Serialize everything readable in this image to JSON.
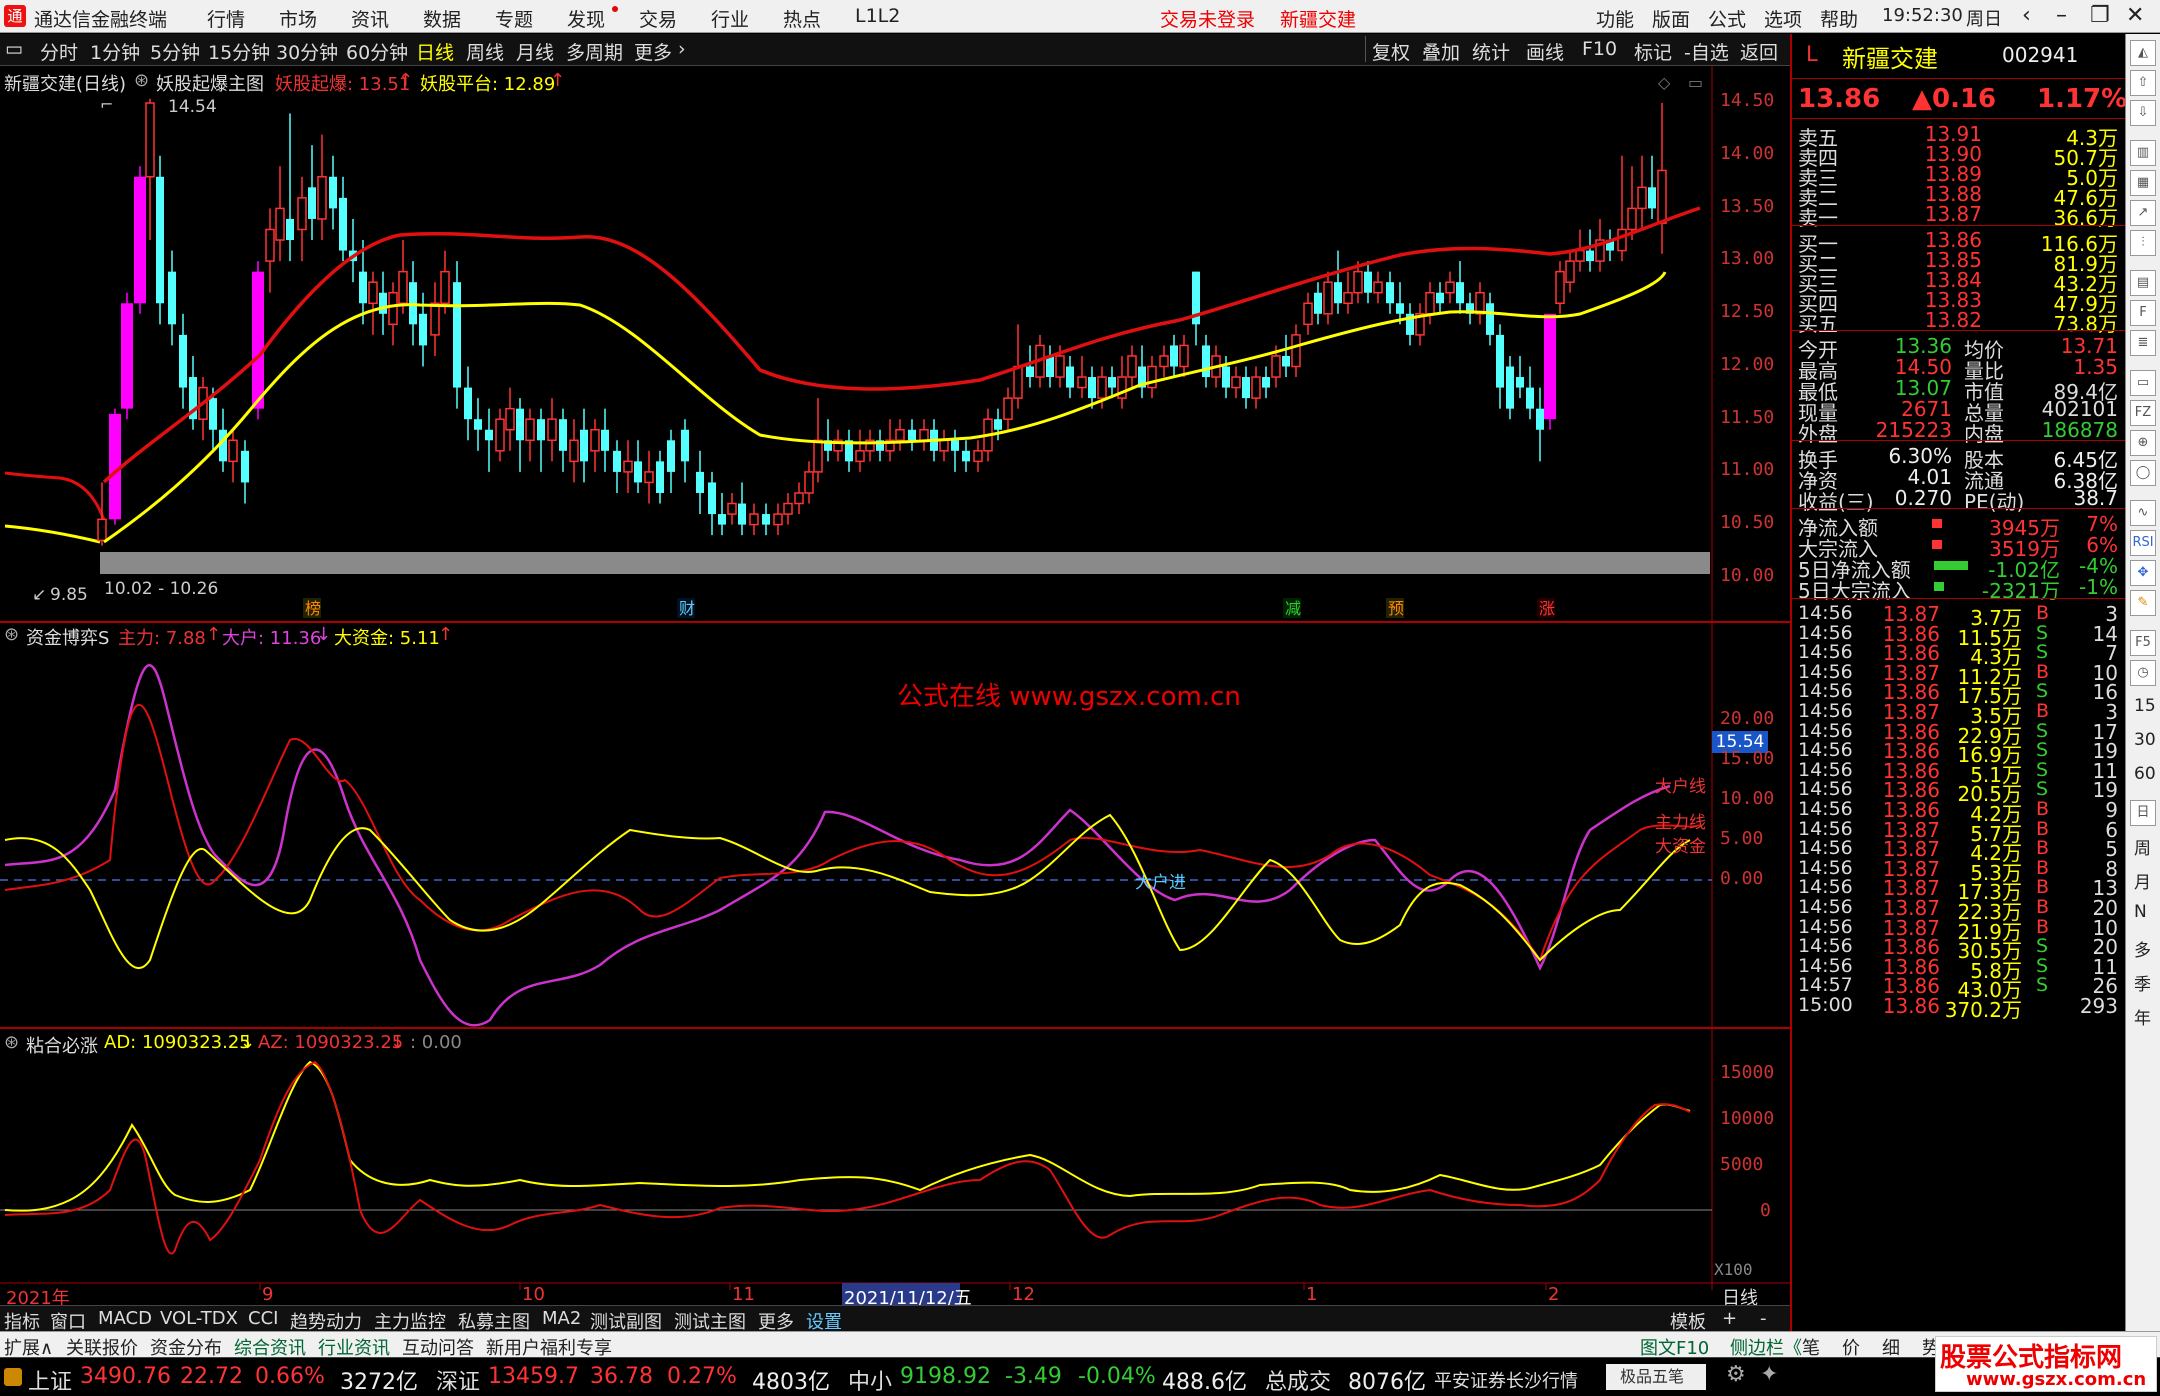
{
  "app": {
    "title": "通达信金融终端",
    "menu": [
      "行情",
      "市场",
      "资讯",
      "数据",
      "专题",
      "发现",
      "交易",
      "行业",
      "热点",
      "L1L2"
    ],
    "trade_status": "交易未登录",
    "stock_name_top": "新疆交建",
    "right_menu": [
      "功能",
      "版面",
      "公式",
      "选项",
      "帮助"
    ],
    "time": "19:52:30",
    "weekday": "周日"
  },
  "toolbar": {
    "periods": [
      "分时",
      "1分钟",
      "5分钟",
      "15分钟",
      "30分钟",
      "60分钟",
      "日线",
      "周线",
      "月线",
      "多周期",
      "更多"
    ],
    "selected": "日线",
    "right": [
      "复权",
      "叠加",
      "统计",
      "画线",
      "F10",
      "标记",
      "-自选",
      "返回"
    ]
  },
  "main": {
    "title": "新疆交建(日线)",
    "indicator": "妖股起爆主图",
    "l1": "妖股起爆: 13.51",
    "l2": "妖股平台: 12.89",
    "high_label": "14.54",
    "low_label": "9.85",
    "range_label": "10.02 - 10.26",
    "yticks": [
      "14.50",
      "14.00",
      "13.50",
      "13.00",
      "12.50",
      "12.00",
      "11.50",
      "11.00",
      "10.50",
      "10.00"
    ],
    "markers": [
      {
        "t": "榜",
        "c": "#f80"
      },
      {
        "t": "财",
        "c": "#6cf"
      },
      {
        "t": "减",
        "c": "#3c3"
      },
      {
        "t": "预",
        "c": "#f80"
      },
      {
        "t": "涨",
        "c": "#f33"
      }
    ]
  },
  "p2": {
    "title": "资金博弈S",
    "l1": "主力: 7.88",
    "l2": "大户: 11.36",
    "l3": "大资金: 5.11",
    "watermark": "公式在线 www.gszx.com.cn",
    "yticks": [
      "20.00",
      "15.00",
      "10.00",
      "5.00",
      "0.00"
    ],
    "cur": "15.54",
    "lab_dahu": "大户线",
    "lab_zhuli": "主力线",
    "lab_dazijin": "大资金",
    "lab_jin": "大户进"
  },
  "p3": {
    "title": "粘合必涨",
    "l1": "AD: 1090323.25",
    "l2": "AZ: 1090323.25",
    "l3": ": 0.00",
    "yticks": [
      "15000",
      "10000",
      "5000",
      "0"
    ],
    "scale": "X100"
  },
  "xaxis": {
    "labels": [
      "2021年",
      "9",
      "10",
      "11",
      "2021/11/12/五",
      "12",
      "1",
      "2"
    ],
    "right": "日线"
  },
  "quote": {
    "code_prefix": "L",
    "name": "新疆交建",
    "code": "002941",
    "price": "13.86",
    "change": "▲0.16",
    "pct": "1.17%",
    "asks": [
      {
        "l": "卖五",
        "p": "13.91",
        "v": "4.3万"
      },
      {
        "l": "卖四",
        "p": "13.90",
        "v": "50.7万"
      },
      {
        "l": "卖三",
        "p": "13.89",
        "v": "5.0万"
      },
      {
        "l": "卖二",
        "p": "13.88",
        "v": "47.6万"
      },
      {
        "l": "卖一",
        "p": "13.87",
        "v": "36.6万"
      }
    ],
    "bids": [
      {
        "l": "买一",
        "p": "13.86",
        "v": "116.6万"
      },
      {
        "l": "买二",
        "p": "13.85",
        "v": "81.9万"
      },
      {
        "l": "买三",
        "p": "13.84",
        "v": "43.2万"
      },
      {
        "l": "买四",
        "p": "13.83",
        "v": "47.9万"
      },
      {
        "l": "买五",
        "p": "13.82",
        "v": "73.8万"
      }
    ],
    "stats": [
      [
        "今开",
        "13.36",
        "均价",
        "13.71"
      ],
      [
        "最高",
        "14.50",
        "量比",
        "1.35"
      ],
      [
        "最低",
        "13.07",
        "市值",
        "89.4亿"
      ],
      [
        "现量",
        "2671",
        "总量",
        "402101"
      ],
      [
        "外盘",
        "215223",
        "内盘",
        "186878"
      ]
    ],
    "stats2": [
      [
        "换手",
        "6.30%",
        "股本",
        "6.45亿"
      ],
      [
        "净资",
        "4.01",
        "流通",
        "6.38亿"
      ],
      [
        "收益(三)",
        "0.270",
        "PE(动)",
        "38.7"
      ]
    ],
    "flows": [
      [
        "净流入额",
        "3945万",
        "7%"
      ],
      [
        "大宗流入",
        "3519万",
        "6%"
      ],
      [
        "5日净流入额",
        "-1.02亿",
        "-4%"
      ],
      [
        "5日大宗流入",
        "-2321万",
        "-1%"
      ]
    ],
    "ticks": [
      [
        "14:56",
        "13.87",
        "3.7万",
        "B",
        "3"
      ],
      [
        "14:56",
        "13.86",
        "11.5万",
        "S",
        "14"
      ],
      [
        "14:56",
        "13.86",
        "4.3万",
        "S",
        "7"
      ],
      [
        "14:56",
        "13.87",
        "11.2万",
        "B",
        "10"
      ],
      [
        "14:56",
        "13.86",
        "17.5万",
        "S",
        "16"
      ],
      [
        "14:56",
        "13.87",
        "3.5万",
        "B",
        "3"
      ],
      [
        "14:56",
        "13.86",
        "22.9万",
        "S",
        "17"
      ],
      [
        "14:56",
        "13.86",
        "16.9万",
        "S",
        "19"
      ],
      [
        "14:56",
        "13.86",
        "5.1万",
        "S",
        "11"
      ],
      [
        "14:56",
        "13.86",
        "20.5万",
        "S",
        "19"
      ],
      [
        "14:56",
        "13.86",
        "4.2万",
        "B",
        "9"
      ],
      [
        "14:56",
        "13.87",
        "5.7万",
        "B",
        "6"
      ],
      [
        "14:56",
        "13.87",
        "4.2万",
        "B",
        "5"
      ],
      [
        "14:56",
        "13.87",
        "5.3万",
        "B",
        "8"
      ],
      [
        "14:56",
        "13.87",
        "17.3万",
        "B",
        "13"
      ],
      [
        "14:56",
        "13.87",
        "22.3万",
        "B",
        "20"
      ],
      [
        "14:56",
        "13.87",
        "21.9万",
        "B",
        "10"
      ],
      [
        "14:56",
        "13.86",
        "30.5万",
        "S",
        "20"
      ],
      [
        "14:56",
        "13.86",
        "5.8万",
        "S",
        "11"
      ],
      [
        "14:57",
        "13.86",
        "43.0万",
        "S",
        "26"
      ],
      [
        "15:00",
        "13.86",
        "370.2万",
        "",
        "293"
      ]
    ]
  },
  "sidebar": [
    "日",
    "周",
    "月",
    "N",
    "多",
    "季",
    "年"
  ],
  "bottom_tabs": [
    "指标",
    "窗口",
    "MACD",
    "VOL-TDX",
    "CCI",
    "趋势动力",
    "主力监控",
    "私募主图",
    "MA2",
    "测试副图",
    "测试主图",
    "更多",
    "设置"
  ],
  "bottom_right": [
    "模板",
    "+",
    "-"
  ],
  "bottom2": [
    "扩展∧",
    "关联报价",
    "资金分布",
    "综合资讯",
    "行业资讯",
    "互动问答",
    "新用户福利专享"
  ],
  "bottom2_right": [
    "图文F10",
    "侧边栏《",
    "笔",
    "价",
    "细",
    "势"
  ],
  "status": [
    {
      "n": "上证",
      "v": "3490.76",
      "c": "22.72",
      "p": "0.66%",
      "a": "3272亿"
    },
    {
      "n": "深证",
      "v": "13459.7",
      "c": "36.78",
      "p": "0.27%",
      "a": "4803亿"
    },
    {
      "n": "中小",
      "v": "9198.92",
      "c": "-3.49",
      "p": "-0.04%",
      "a": "488.6亿"
    }
  ],
  "status_extra": {
    "total_label": "总成交",
    "total": "8076亿",
    "broker": "平安证券长沙行情",
    "badge": "极品五笔"
  },
  "site_watermark": {
    "t1": "股票公式指标网",
    "t2": "www.gszx.com.cn"
  },
  "colors": {
    "up": "#ff3333",
    "down": "#54ffff",
    "yao": "#ff00ff",
    "ma_red": "#e01010",
    "ma_yellow": "#ffff00",
    "purple": "#cc33cc"
  }
}
